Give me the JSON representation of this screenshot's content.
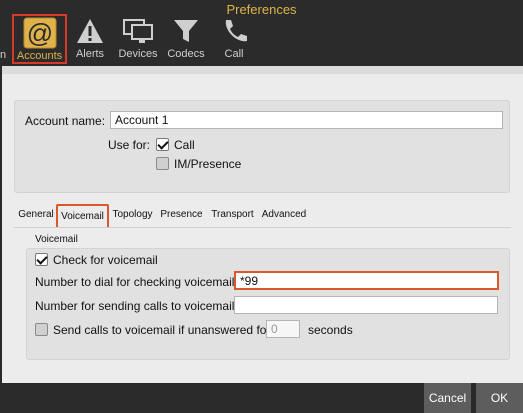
{
  "window": {
    "title": "Preferences"
  },
  "toolbar": {
    "cut_label": "n",
    "items": [
      {
        "label": "Accounts",
        "icon": "at-sign-icon",
        "active": true
      },
      {
        "label": "Alerts",
        "icon": "warning-triangle-icon",
        "active": false
      },
      {
        "label": "Devices",
        "icon": "monitor-icon",
        "active": false
      },
      {
        "label": "Codecs",
        "icon": "funnel-icon",
        "active": false
      },
      {
        "label": "Call",
        "icon": "phone-icon",
        "active": false
      }
    ]
  },
  "account": {
    "name_label": "Account name:",
    "name_value": "Account 1",
    "use_for_label": "Use for:",
    "call_label": "Call",
    "call_checked": true,
    "im_label": "IM/Presence",
    "im_checked": false
  },
  "tabs": [
    {
      "label": "General",
      "active": false
    },
    {
      "label": "Voicemail",
      "active": true
    },
    {
      "label": "Topology",
      "active": false
    },
    {
      "label": "Presence",
      "active": false
    },
    {
      "label": "Transport",
      "active": false
    },
    {
      "label": "Advanced",
      "active": false
    }
  ],
  "voicemail": {
    "section_title": "Voicemail",
    "check_label": "Check for voicemail",
    "check_checked": true,
    "dial_label": "Number to dial for checking voicemail",
    "dial_value": "*99",
    "send_label": "Number for sending calls to voicemail",
    "send_value": "",
    "unanswered_label": "Send calls to voicemail if unanswered for",
    "unanswered_checked": false,
    "unanswered_value": "0",
    "seconds_label": "seconds"
  },
  "buttons": {
    "cancel": "Cancel",
    "ok": "OK"
  },
  "colors": {
    "accent": "#e0b34a",
    "highlight": "#d85a2a",
    "toolbar_bg": "#2b2b2b"
  }
}
